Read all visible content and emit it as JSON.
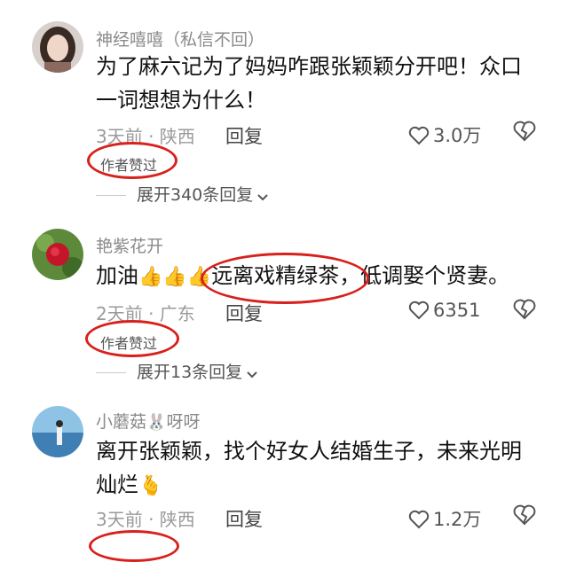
{
  "comments": [
    {
      "username": "神经嘻嘻（私信不回）",
      "text_line1": "为了麻六记为了妈妈咋跟张颖颖分开吧！众口",
      "text_line2": "一词想想为什么！",
      "time": "3天前 · 陕西",
      "reply": "回复",
      "likes": "3.0万",
      "badge": "作者赞过",
      "expand": "展开340条回复"
    },
    {
      "username": "艳紫花开",
      "text_prefix": "加油",
      "text_highlight": "远离戏精绿茶",
      "text_suffix": "，低调娶个贤妻。",
      "time": "2天前 · 广东",
      "reply": "回复",
      "likes": "6351",
      "badge": "作者赞过",
      "expand": "展开13条回复"
    },
    {
      "username": "小蘑菇",
      "username_suffix": "呀呀",
      "text_line1": "离开张颖颖，找个好女人结婚生子，未来光明",
      "text_line2": "灿烂",
      "time": "3天前 · 陕西",
      "reply": "回复",
      "likes": "1.2万"
    }
  ],
  "colors": {
    "accent_red": "#d8201c",
    "meta_gray": "#9a9a9a"
  },
  "icons": [
    "heart-outline-icon",
    "broken-heart-icon",
    "chevron-down-icon",
    "thumbs-up-emoji",
    "finger-heart-emoji",
    "rabbit-emoji"
  ]
}
